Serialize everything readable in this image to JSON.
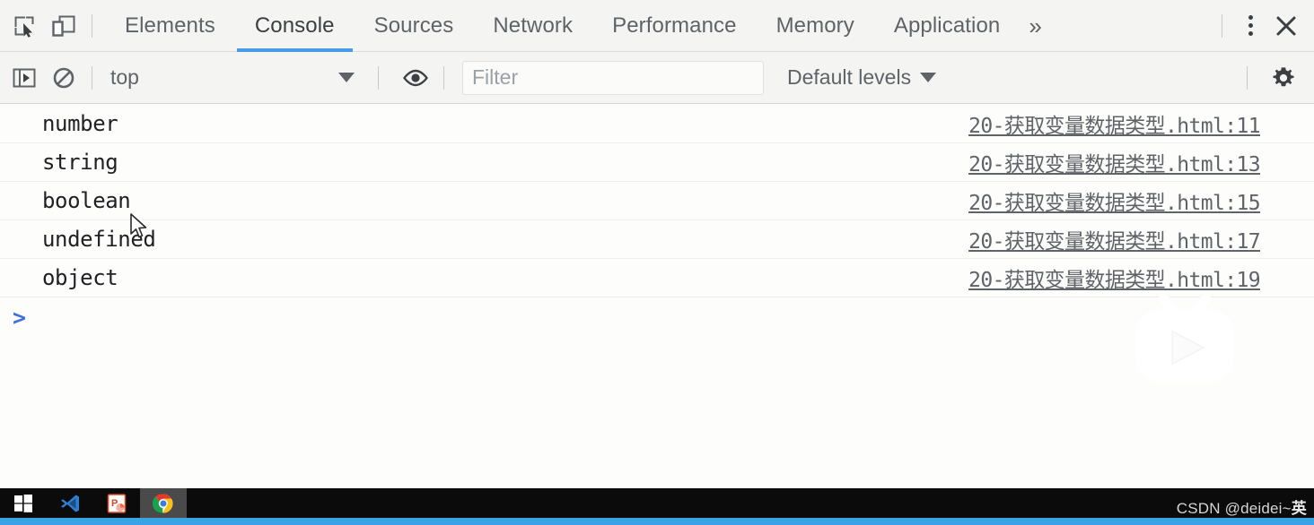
{
  "window": {
    "app": "Chrome DevTools"
  },
  "tabbar": {
    "inspect_icon": "inspect-element-icon",
    "device_icon": "device-toolbar-icon",
    "tabs": [
      {
        "label": "Elements",
        "active": false
      },
      {
        "label": "Console",
        "active": true
      },
      {
        "label": "Sources",
        "active": false
      },
      {
        "label": "Network",
        "active": false
      },
      {
        "label": "Performance",
        "active": false
      },
      {
        "label": "Memory",
        "active": false
      },
      {
        "label": "Application",
        "active": false
      }
    ],
    "more_tabs": "»",
    "kebab_icon": "more-options-icon",
    "close_icon": "close-icon",
    "active_underline_color": "#4a9ae8"
  },
  "console_toolbar": {
    "sidebar_toggle_icon": "console-sidebar-icon",
    "clear_icon": "clear-console-icon",
    "context_value": "top",
    "eye_icon": "live-expression-icon",
    "filter_placeholder": "Filter",
    "filter_value": "",
    "levels_label": "Default levels",
    "settings_icon": "settings-gear-icon"
  },
  "console_messages": [
    {
      "text": "number",
      "source": "20-获取变量数据类型.html:11"
    },
    {
      "text": "string",
      "source": "20-获取变量数据类型.html:13"
    },
    {
      "text": "boolean",
      "source": "20-获取变量数据类型.html:15"
    },
    {
      "text": "undefined",
      "source": "20-获取变量数据类型.html:17"
    },
    {
      "text": "object",
      "source": "20-获取变量数据类型.html:19"
    }
  ],
  "prompt": {
    "caret": ">",
    "value": "",
    "caret_color": "#4071d5"
  },
  "watermark": {
    "icon": "bilibili-play-watermark-icon",
    "color": "#ffffff"
  },
  "taskbar": {
    "items": [
      {
        "name": "start-button",
        "icon": "windows-logo-icon",
        "active": false
      },
      {
        "name": "vscode",
        "icon": "vscode-icon",
        "active": false
      },
      {
        "name": "powerpoint",
        "icon": "powerpoint-icon",
        "active": false
      },
      {
        "name": "chrome",
        "icon": "chrome-icon",
        "active": true
      }
    ],
    "accent_color": "#3aa3e3"
  },
  "credit": {
    "prefix": "CSDN @deidei~",
    "suffix": "英"
  }
}
